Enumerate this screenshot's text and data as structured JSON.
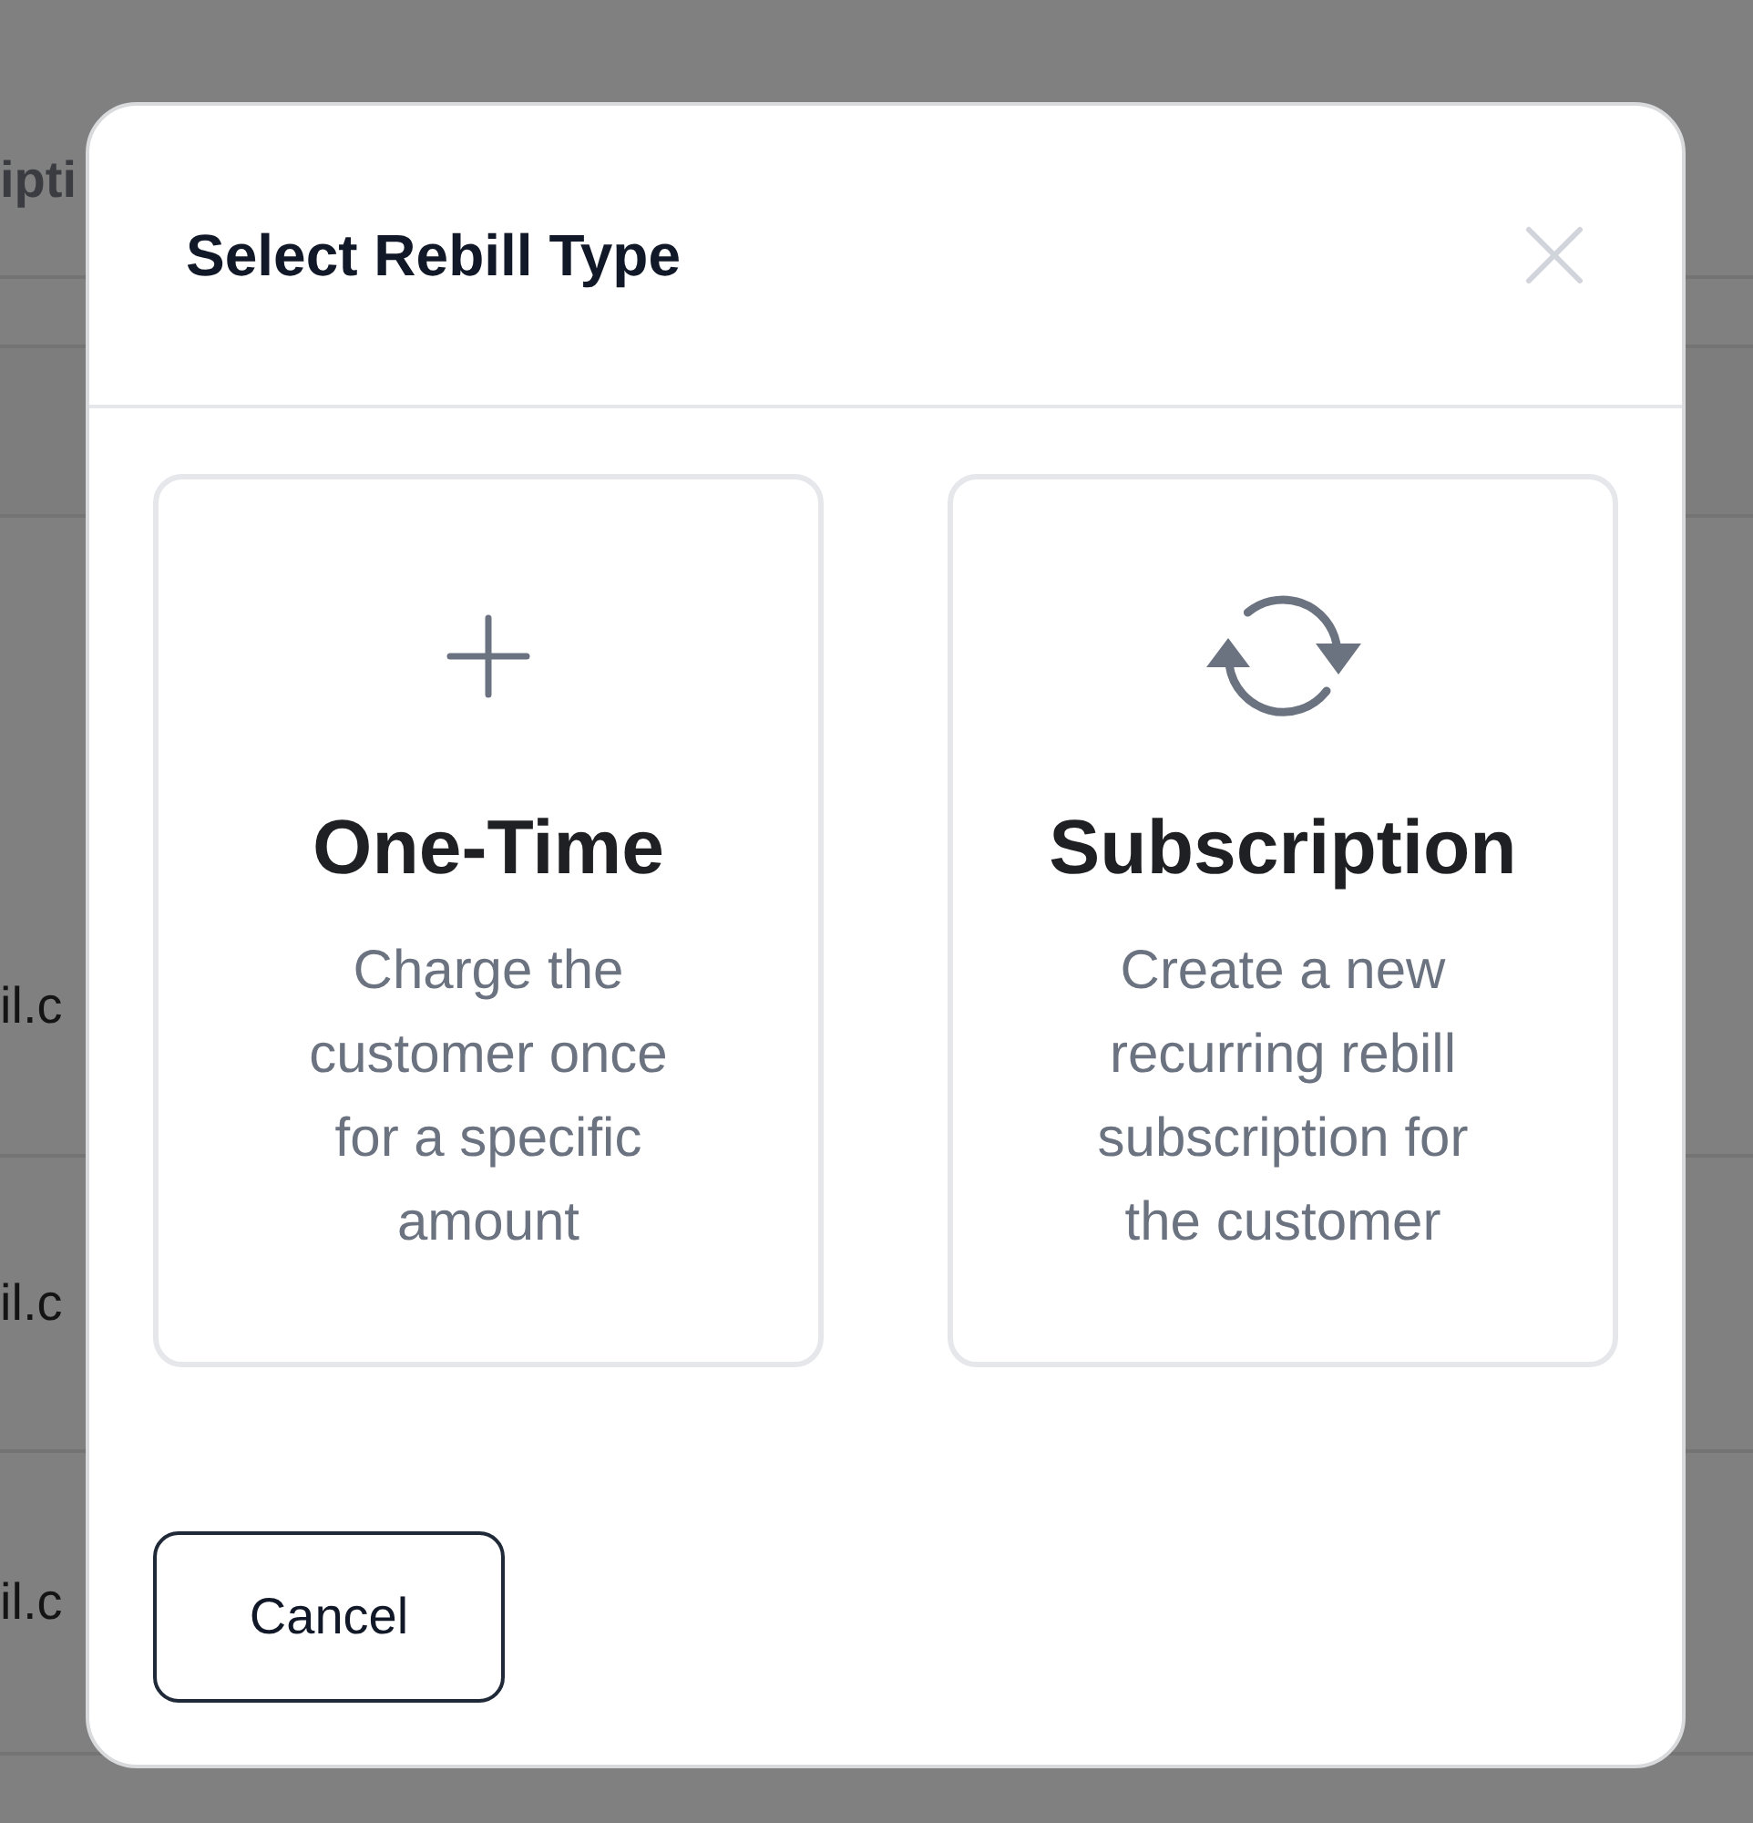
{
  "background_table": {
    "header": "ipti",
    "rows": [
      "il.c",
      "il.c",
      "il.c"
    ]
  },
  "dialog": {
    "title": "Select Rebill Type",
    "options": [
      {
        "kind": "one_time",
        "title": "One-Time",
        "description": "Charge the customer once for a specific amount"
      },
      {
        "kind": "subscription",
        "title": "Subscription",
        "description": "Create a new recurring rebill subscription for the customer"
      }
    ],
    "buttons": [
      {
        "label": "Cancel"
      }
    ]
  }
}
